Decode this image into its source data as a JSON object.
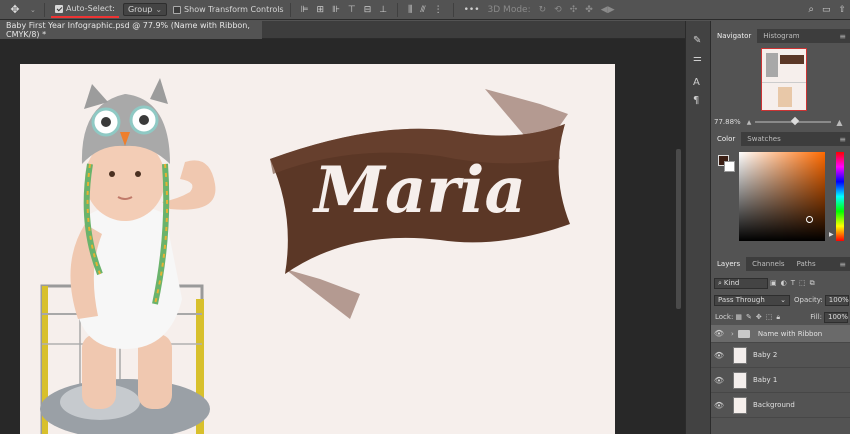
{
  "options_bar": {
    "auto_select_label": "Auto-Select:",
    "auto_select_checked": true,
    "target_value": "Group",
    "transform_controls_label": "Show Transform Controls",
    "transform_controls_checked": false,
    "mode_3d_label": "3D Mode:",
    "more_label": "•••"
  },
  "document": {
    "tab_title": "Baby First Year Infographic.psd @ 77.9% (Name with Ribbon, CMYK/8) *"
  },
  "artwork": {
    "name_text": "Maria"
  },
  "navigator": {
    "tabs": [
      "Navigator",
      "Histogram"
    ],
    "zoom": "77.88%"
  },
  "color_panel": {
    "tabs": [
      "Color",
      "Swatches"
    ],
    "foreground": "#3b1f14",
    "background": "#ffffff"
  },
  "layers_panel": {
    "tabs": [
      "Layers",
      "Channels",
      "Paths"
    ],
    "filter_kind": "Kind",
    "blend_mode": "Pass Through",
    "opacity_label": "Opacity:",
    "opacity_value": "100%",
    "lock_label": "Lock:",
    "fill_label": "Fill:",
    "fill_value": "100%",
    "layers": [
      {
        "name": "Name with Ribbon",
        "type": "group",
        "selected": true
      },
      {
        "name": "Baby 2",
        "type": "smart",
        "selected": false
      },
      {
        "name": "Baby 1",
        "type": "smart",
        "selected": false
      },
      {
        "name": "Background",
        "type": "pixel",
        "selected": false
      }
    ]
  }
}
